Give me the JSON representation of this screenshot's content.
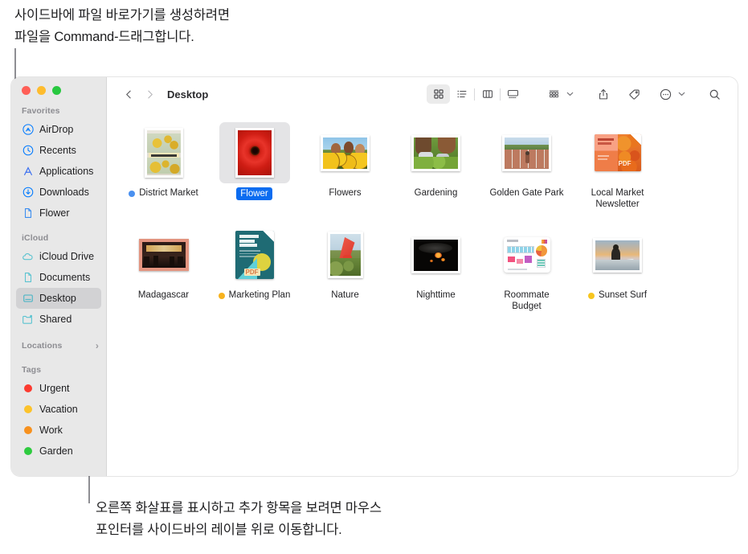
{
  "callouts": {
    "top": "사이드바에 파일 바로가기를 생성하려면\n파일을 Command-드래그합니다.",
    "bottom": "오른쪽 화살표를 표시하고 추가 항목을 보려면 마우스\n포인터를 사이드바의 레이블 위로 이동합니다."
  },
  "window": {
    "traffic_lights": [
      "close",
      "minimize",
      "zoom"
    ],
    "colors": {
      "close": "#ff5f57",
      "minimize": "#febc2e",
      "zoom": "#28c840",
      "accent_blue": "#007aff",
      "selection_blue": "#0b6cf0",
      "icloud_teal": "#5ac3d0",
      "sidebar_bg": "#e8e8e8"
    }
  },
  "toolbar": {
    "back_label": "‹",
    "forward_label": "›",
    "breadcrumb": "Desktop",
    "buttons": [
      {
        "name": "icon-view",
        "icon": "grid-icon",
        "active": true
      },
      {
        "name": "list-view",
        "icon": "list-icon",
        "active": false
      },
      {
        "name": "column-view",
        "icon": "columns-icon",
        "active": false
      },
      {
        "name": "gallery-view",
        "icon": "gallery-icon",
        "active": false
      },
      {
        "name": "group-by",
        "icon": "group-by-icon",
        "active": false
      },
      {
        "name": "share",
        "icon": "share-icon",
        "active": false
      },
      {
        "name": "tags",
        "icon": "tag-icon",
        "active": false
      },
      {
        "name": "more-actions",
        "icon": "ellipsis-circle-icon",
        "active": false
      },
      {
        "name": "search",
        "icon": "search-icon",
        "active": false
      }
    ]
  },
  "sidebar": {
    "sections": [
      {
        "header": "Favorites",
        "chevron": "",
        "items": [
          {
            "label": "AirDrop",
            "icon": "airdrop-icon",
            "color": "#007aff",
            "selected": false
          },
          {
            "label": "Recents",
            "icon": "clock-icon",
            "color": "#007aff",
            "selected": false
          },
          {
            "label": "Applications",
            "icon": "applications-icon",
            "color": "#3a6ff0",
            "selected": false
          },
          {
            "label": "Downloads",
            "icon": "download-circle-icon",
            "color": "#007aff",
            "selected": false
          },
          {
            "label": "Flower",
            "icon": "document-icon",
            "color": "#3a8df0",
            "selected": false
          }
        ]
      },
      {
        "header": "iCloud",
        "chevron": "",
        "items": [
          {
            "label": "iCloud Drive",
            "icon": "cloud-icon",
            "color": "#5ac3d0",
            "selected": false
          },
          {
            "label": "Documents",
            "icon": "document-icon",
            "color": "#5ac3d0",
            "selected": false
          },
          {
            "label": "Desktop",
            "icon": "desktop-icon",
            "color": "#3fb3c4",
            "selected": true
          },
          {
            "label": "Shared",
            "icon": "shared-folder-icon",
            "color": "#5ac3d0",
            "selected": false
          }
        ]
      },
      {
        "header": "Locations",
        "chevron": "›",
        "items": []
      },
      {
        "header": "Tags",
        "chevron": "",
        "items": [
          {
            "label": "Urgent",
            "icon": "tag-dot",
            "color": "#fc3b30",
            "selected": false
          },
          {
            "label": "Vacation",
            "icon": "tag-dot",
            "color": "#fcc32b",
            "selected": false
          },
          {
            "label": "Work",
            "icon": "tag-dot",
            "color": "#f7911e",
            "selected": false
          },
          {
            "label": "Garden",
            "icon": "tag-dot",
            "color": "#2ecb3f",
            "selected": false
          }
        ]
      }
    ]
  },
  "files": [
    {
      "name": "District Market",
      "kind": "photo-portrait",
      "tag": "#4a90f0",
      "selected": false
    },
    {
      "name": "Flower",
      "kind": "photo-portrait",
      "tag": "",
      "selected": true
    },
    {
      "name": "Flowers",
      "kind": "photo-landscape",
      "tag": "",
      "selected": false
    },
    {
      "name": "Gardening",
      "kind": "photo-landscape",
      "tag": "",
      "selected": false
    },
    {
      "name": "Golden Gate Park",
      "kind": "photo-landscape",
      "tag": "",
      "selected": false
    },
    {
      "name": "Local Market\nNewsletter",
      "kind": "pdf-market",
      "tag": "",
      "selected": false
    },
    {
      "name": "Madagascar",
      "kind": "photo-landscape",
      "tag": "",
      "selected": false
    },
    {
      "name": "Marketing Plan",
      "kind": "pdf-marketing",
      "tag": "#f7b21e",
      "selected": false
    },
    {
      "name": "Nature",
      "kind": "photo-portrait",
      "tag": "",
      "selected": false
    },
    {
      "name": "Nighttime",
      "kind": "photo-landscape",
      "tag": "",
      "selected": false
    },
    {
      "name": "Roommate\nBudget",
      "kind": "numbers-doc",
      "tag": "",
      "selected": false
    },
    {
      "name": "Sunset Surf",
      "kind": "photo-landscape",
      "tag": "#f7c51e",
      "selected": false
    }
  ]
}
